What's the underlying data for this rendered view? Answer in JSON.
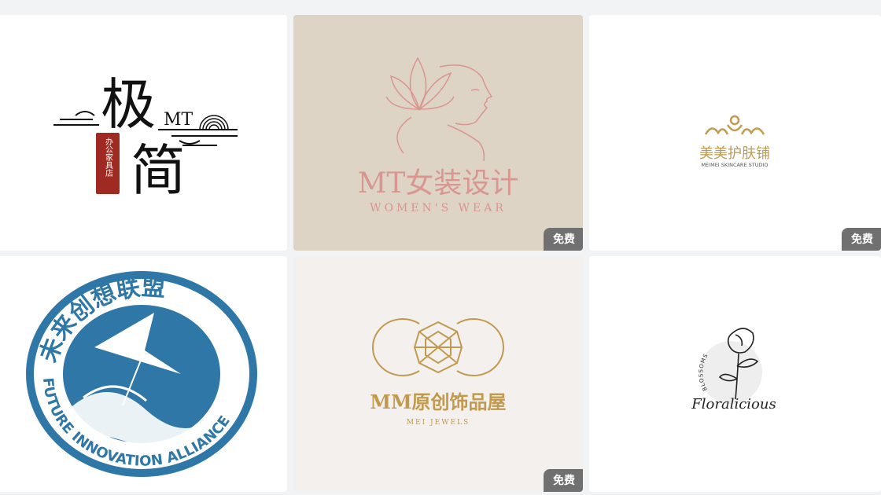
{
  "badge_label": "免费",
  "colors": {
    "page_bg": "#f2f3f5",
    "badge_bg": "#707070",
    "pink": "#d9958f",
    "gold": "#c19a4e",
    "blue": "#2f77a6",
    "ink": "#111111",
    "seal_red": "#9e2a22"
  },
  "cards": [
    {
      "id": "jijian",
      "free": false,
      "chars": [
        "极",
        "简"
      ],
      "mark": "MT",
      "seal": "办公家具店"
    },
    {
      "id": "mt-womens",
      "free": true,
      "title": "MT女装设计",
      "subtitle": "WOMEN'S WEAR"
    },
    {
      "id": "meimei",
      "free": true,
      "title": "美美护肤铺",
      "subtitle": "MEIMEI SKINCARE STUDIO"
    },
    {
      "id": "future",
      "free": false,
      "cn_text": "未来创想联盟",
      "en_text": "FUTURE INNOVATION ALLIANCE"
    },
    {
      "id": "mm-jewels",
      "free": true,
      "title": "MM原创饰品屋",
      "subtitle": "MEI JEWELS"
    },
    {
      "id": "floralicious",
      "free": false,
      "title": "Floralicious",
      "arc_text": "BLOSSOMS"
    }
  ]
}
